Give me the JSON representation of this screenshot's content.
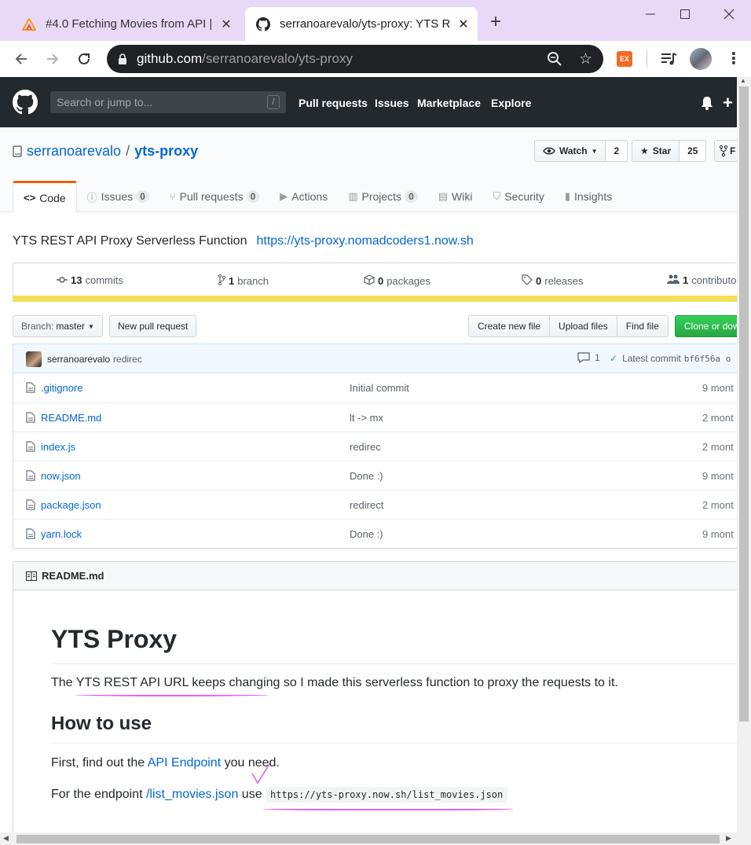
{
  "browser": {
    "tabs": [
      {
        "title": "#4.0 Fetching Movies from API | ",
        "close": "✕",
        "icon": "nomad-icon"
      },
      {
        "title": "serranoarevalo/yts-proxy: YTS R",
        "close": "✕",
        "icon": "github-icon"
      }
    ],
    "new_tab": "+",
    "url_host": "github.com",
    "url_path": "/serranoarevalo/yts-proxy",
    "ext_label": "EX"
  },
  "gh": {
    "search_placeholder": "Search or jump to...",
    "search_key": "/",
    "nav": [
      "Pull requests",
      "Issues",
      "Marketplace",
      "Explore"
    ]
  },
  "repo": {
    "owner": "serranoarevalo",
    "sep": "/",
    "name": "yts-proxy",
    "watch_label": "Watch",
    "watch_count": "2",
    "star_label": "Star",
    "star_count": "25",
    "fork_label": "F",
    "tabs": [
      {
        "label": "Code",
        "count": ""
      },
      {
        "label": "Issues",
        "count": "0"
      },
      {
        "label": "Pull requests",
        "count": "0"
      },
      {
        "label": "Actions",
        "count": ""
      },
      {
        "label": "Projects",
        "count": "0"
      },
      {
        "label": "Wiki",
        "count": ""
      },
      {
        "label": "Security",
        "count": ""
      },
      {
        "label": "Insights",
        "count": ""
      }
    ],
    "description": "YTS REST API Proxy Serverless Function",
    "homepage": "https://yts-proxy.nomadcoders1.now.sh",
    "summary": {
      "commits_num": "13",
      "commits_label": "commits",
      "branch_num": "1",
      "branch_label": "branch",
      "packages_num": "0",
      "packages_label": "packages",
      "releases_num": "0",
      "releases_label": "releases",
      "contrib_num": "1",
      "contrib_label": "contributo"
    },
    "lang_color": "#f1e05a"
  },
  "filenav": {
    "branch_prefix": "Branch:",
    "branch": "master",
    "new_pr": "New pull request",
    "create_file": "Create new file",
    "upload_files": "Upload files",
    "find_file": "Find file",
    "clone": "Clone or dow"
  },
  "commit": {
    "author": "serranoarevalo",
    "message": "redirec",
    "comments": "1",
    "latest_label": "Latest commit",
    "sha": "bf6f56a o"
  },
  "files": [
    {
      "name": ".gitignore",
      "message": "Initial commit",
      "age": "9 mont"
    },
    {
      "name": "README.md",
      "message": "lt -> mx",
      "age": "2 mont"
    },
    {
      "name": "index.js",
      "message": "redirec",
      "age": "2 mont"
    },
    {
      "name": "now.json",
      "message": "Done :)",
      "age": "9 mont"
    },
    {
      "name": "package.json",
      "message": "redirect",
      "age": "2 mont"
    },
    {
      "name": "yarn.lock",
      "message": "Done :)",
      "age": "9 mont"
    }
  ],
  "readme": {
    "header": "README.md",
    "h1": "YTS Proxy",
    "p1_a": "The ",
    "p1_b": "YTS REST API URL keeps changing",
    "p1_c": " so I made this serverless function to proxy the requests to it.",
    "h2": "How to use",
    "p2_a": "First, find out the ",
    "p2_link": "API Endpoint",
    "p2_b": " you need.",
    "p3_a": "For the endpoint ",
    "p3_link": "/list_movies.json",
    "p3_b": " use ",
    "p3_code": "https://yts-proxy.now.sh/list_movies.json"
  }
}
